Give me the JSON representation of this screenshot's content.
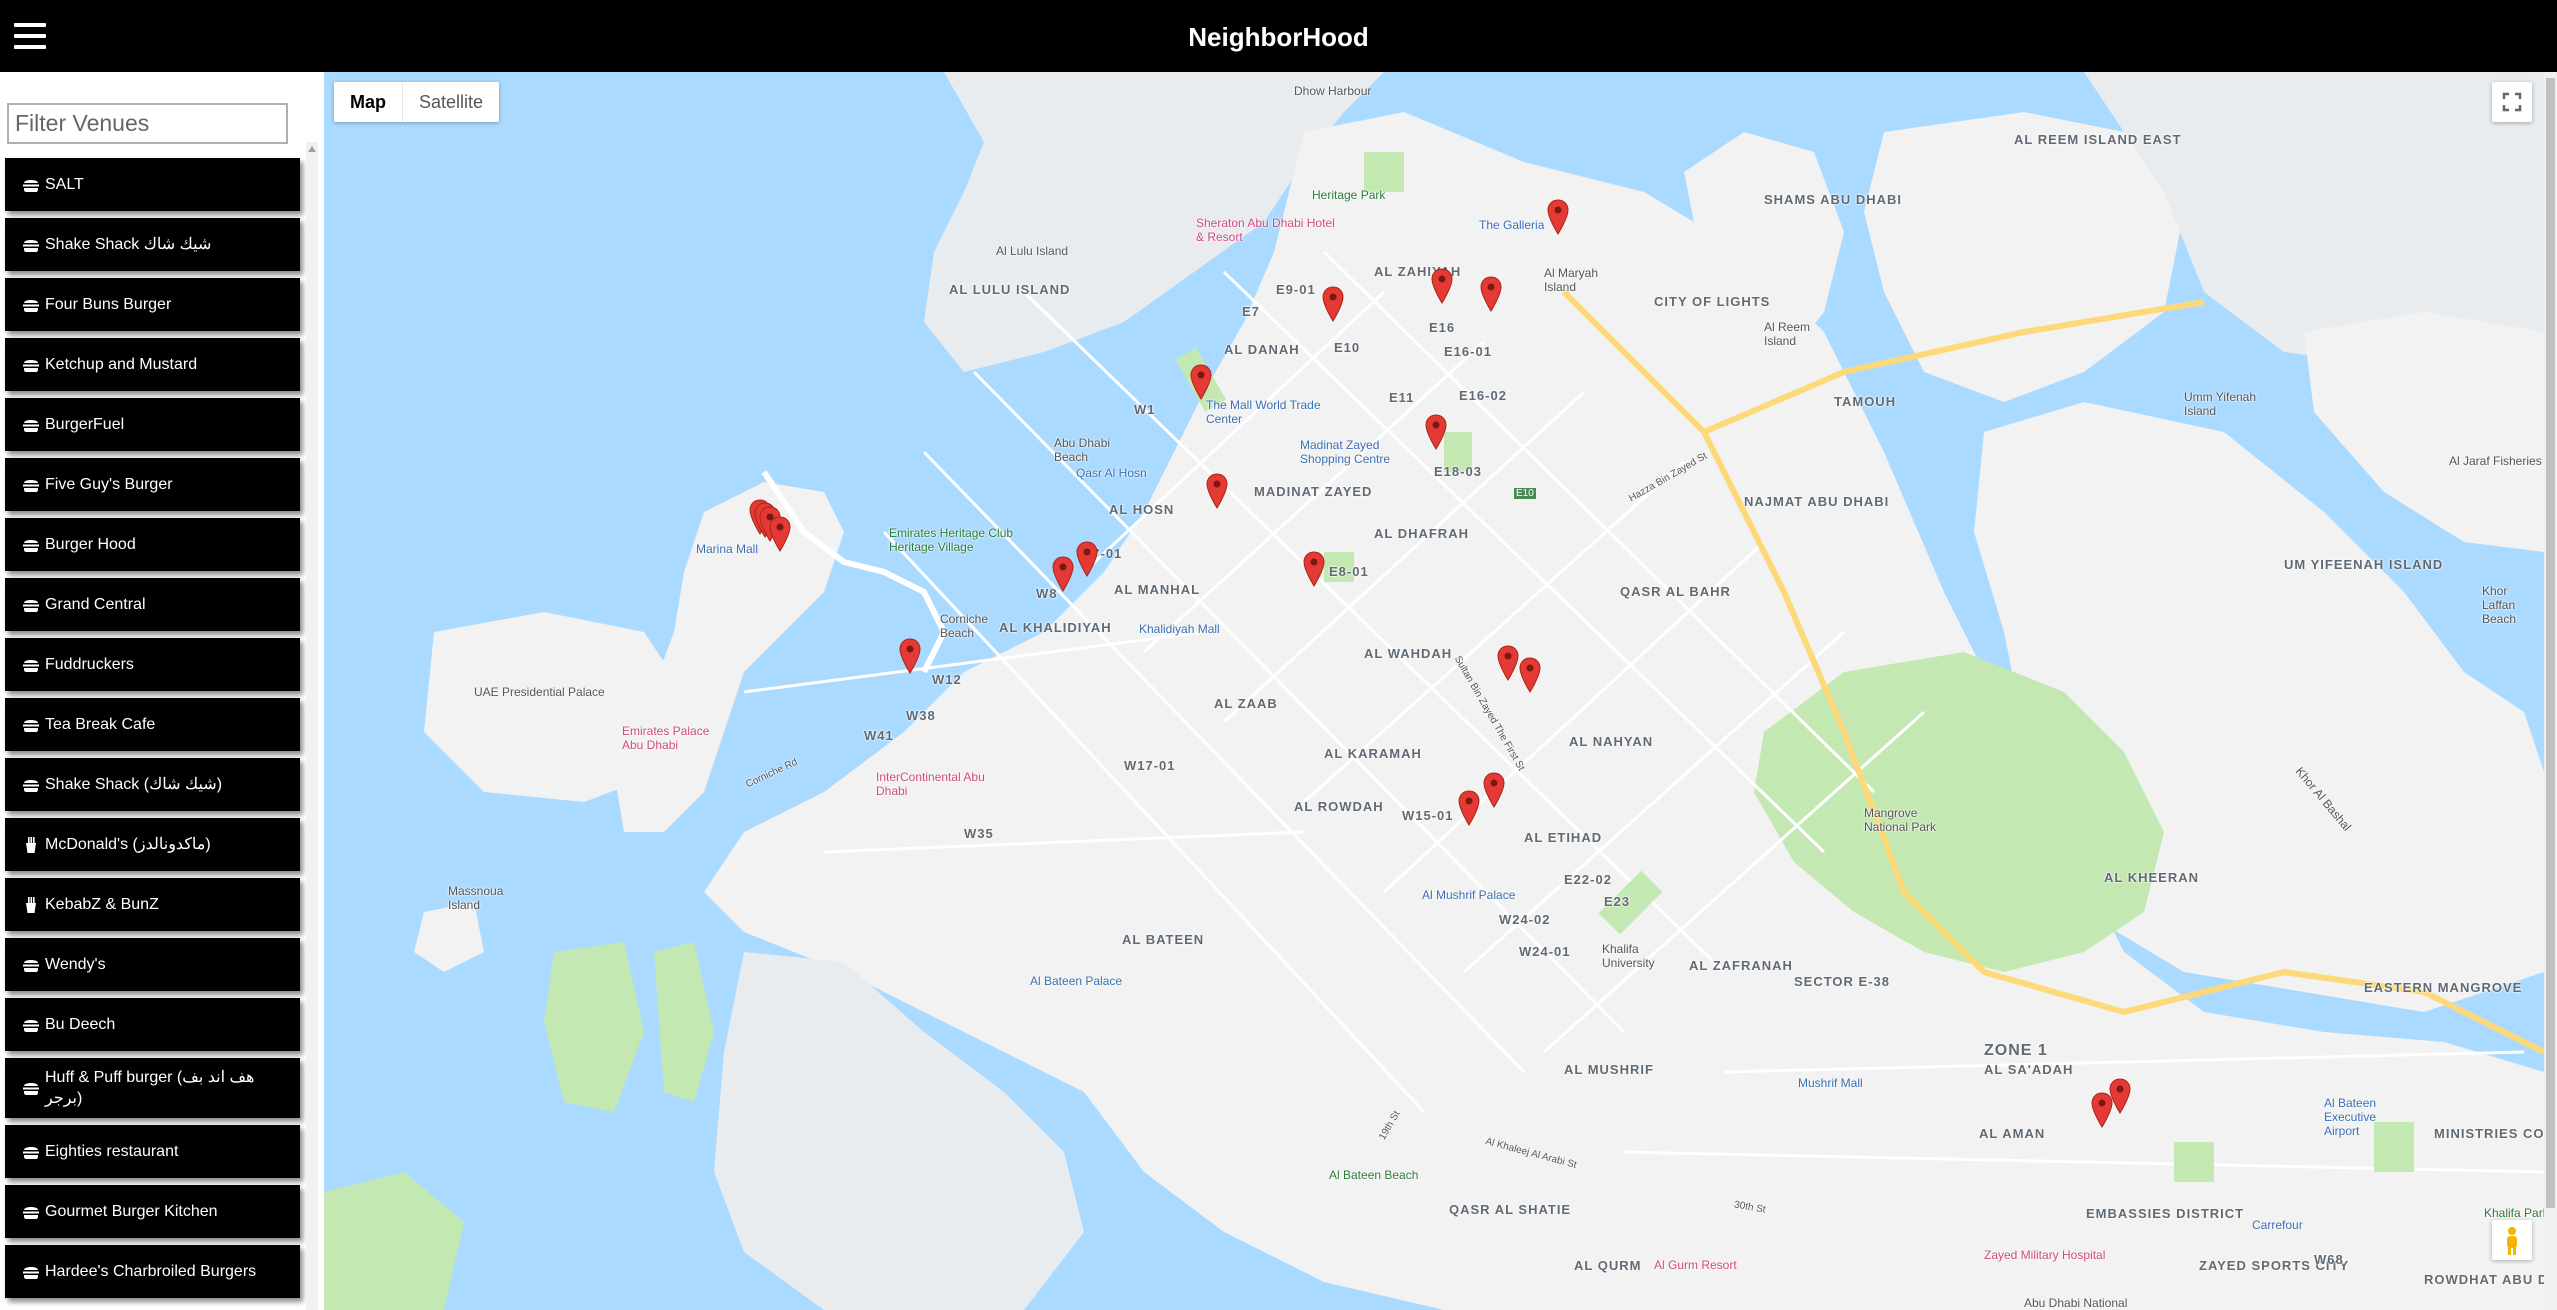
{
  "app": {
    "title": "NeighborHood"
  },
  "filter": {
    "placeholder": "Filter Venues",
    "value": ""
  },
  "venues": [
    {
      "name": "SALT",
      "icon": "burger-icon"
    },
    {
      "name": "Shake Shack شيك شاك",
      "icon": "burger-icon"
    },
    {
      "name": "Four Buns Burger",
      "icon": "burger-icon"
    },
    {
      "name": "Ketchup and Mustard",
      "icon": "burger-icon"
    },
    {
      "name": "BurgerFuel",
      "icon": "burger-icon"
    },
    {
      "name": "Five Guy's Burger",
      "icon": "burger-icon"
    },
    {
      "name": "Burger Hood",
      "icon": "burger-icon"
    },
    {
      "name": "Grand Central",
      "icon": "burger-icon"
    },
    {
      "name": "Fuddruckers",
      "icon": "burger-icon"
    },
    {
      "name": "Tea Break Cafe",
      "icon": "burger-icon"
    },
    {
      "name": "Shake Shack (شيك شاك)",
      "icon": "burger-icon"
    },
    {
      "name": "McDonald's (ماكدونالدز)",
      "icon": "fries-icon"
    },
    {
      "name": "KebabZ & BunZ",
      "icon": "fries-icon"
    },
    {
      "name": "Wendy's",
      "icon": "burger-icon"
    },
    {
      "name": "Bu Deech",
      "icon": "burger-icon"
    },
    {
      "name": "Huff & Puff burger (هف اند بف برجر)",
      "icon": "burger-icon"
    },
    {
      "name": "Eighties restaurant",
      "icon": "burger-icon"
    },
    {
      "name": "Gourmet Burger Kitchen",
      "icon": "burger-icon"
    },
    {
      "name": "Hardee's Charbroiled Burgers",
      "icon": "burger-icon"
    }
  ],
  "map": {
    "type_control": {
      "map": "Map",
      "satellite": "Satellite",
      "selected": "Map"
    },
    "district_labels": [
      "AL LULU ISLAND",
      "AL ZAHIYAH",
      "AL DANAH",
      "E10",
      "E16",
      "E16-01",
      "E16-02",
      "E11",
      "E9-01",
      "E7",
      "W1",
      "MADINAT ZAYED",
      "AL HOSN",
      "W7-01",
      "W8",
      "AL MANHAL",
      "AL KHALIDIYAH",
      "AL DHAFRAH",
      "E18-03",
      "E8-01",
      "AL WAHDAH",
      "W12",
      "W38",
      "W41",
      "AL ZAAB",
      "W17-01",
      "AL KARAMAH",
      "AL ROWDAH",
      "W15-01",
      "AL ETIHAD",
      "W35",
      "AL BATEEN",
      "E22-02",
      "E23",
      "W24-02",
      "W24-01",
      "AL ZAFRANAH",
      "SECTOR E-38",
      "AL NAHYAN",
      "QASR AL BAHR",
      "CITY OF LIGHTS",
      "TAMOUH",
      "NAJMAT ABU DHABI",
      "SHAMS ABU DHABI",
      "AL REEM ISLAND EAST",
      "UM YIFEENAH ISLAND",
      "AL KHEERAN",
      "ZONE 1",
      "AL SA'ADAH",
      "AL AMAN",
      "EMBASSIES DISTRICT",
      "EASTERN MANGROVE",
      "MINISTRIES COMPLEX",
      "AL MUSHRIF",
      "QASR AL SHATIE",
      "AL QURM",
      "ZAYED SPORTS CITY",
      "ROWDHAT ABU DHABI",
      "W68"
    ],
    "poi_labels": [
      "Dhow Harbour",
      "Heritage Park",
      "Sheraton Abu Dhabi Hotel & Resort",
      "Al Lulu Island",
      "The Galleria",
      "Al Maryah Island",
      "Al Reem Island",
      "The Mall World Trade Center",
      "Madinat Zayed Shopping Centre",
      "Qasr Al Hosn",
      "Abu Dhabi Beach",
      "Marina Mall",
      "Emirates Heritage Club Heritage Village",
      "Corniche Beach",
      "Khalidiyah Mall",
      "UAE Presidential Palace",
      "Emirates Palace Abu Dhabi",
      "InterContinental Abu Dhabi",
      "Massnoua Island",
      "Al Bateen Palace",
      "Al Mushrif Palace",
      "Khalifa University",
      "Mangrove National Park",
      "Umm Yifenah Island",
      "Al Jaraf Fisheries",
      "Khor Laffan Beach",
      "Mushrif Mall",
      "Al Bateen Beach",
      "Zayed Military Hospital",
      "Al Gurm Resort",
      "Al Bateen Executive Airport",
      "Carrefour",
      "Khalifa Park",
      "Khor Al Bashal",
      "Abu Dhabi National"
    ],
    "road_labels": [
      "E10",
      "Hazza Bin Zayed St",
      "Sultan Bin Zayed The First St",
      "Al Khaleej Al Arabi St",
      "Corniche Rd",
      "19th St",
      "30th St"
    ],
    "marker_count": 24,
    "marker_color": "#e53935"
  },
  "colors": {
    "header_bg": "#000000",
    "sidebar_item_bg": "#000000",
    "water": "#aadaff",
    "land": "#f2f2f2",
    "park": "#c4e8b1",
    "road_major": "#fdd97a"
  }
}
